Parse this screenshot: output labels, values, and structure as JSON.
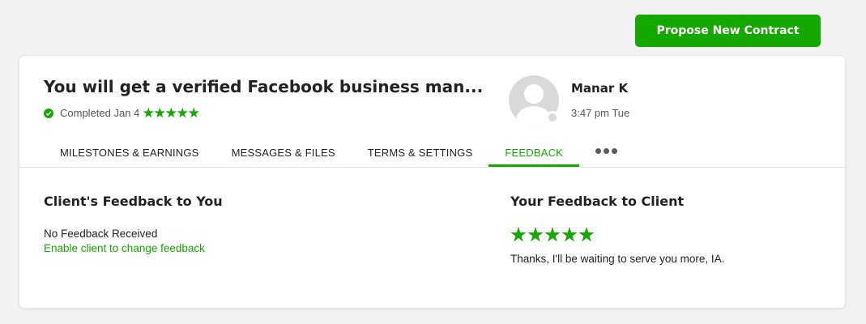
{
  "header": {
    "propose_button": "Propose New Contract"
  },
  "contract": {
    "title": "You will get a verified Facebook business man...",
    "status_text": "Completed Jan 4",
    "status_rating": 5
  },
  "client": {
    "name": "Manar K",
    "local_time": "3:47 pm Tue"
  },
  "tabs": [
    {
      "label": "MILESTONES & EARNINGS",
      "active": false
    },
    {
      "label": "MESSAGES & FILES",
      "active": false
    },
    {
      "label": "TERMS & SETTINGS",
      "active": false
    },
    {
      "label": "FEEDBACK",
      "active": true
    }
  ],
  "feedback": {
    "client_heading": "Client's Feedback to You",
    "client_status": "No Feedback Received",
    "enable_link": "Enable client to change feedback",
    "your_heading": "Your Feedback to Client",
    "your_rating": 5,
    "your_comment": "Thanks, I'll be waiting to serve you more, IA."
  },
  "colors": {
    "accent": "#14a800",
    "background": "#f2f2f2",
    "avatar_placeholder": "#d9d9d9"
  },
  "icons": [
    "check-circle-icon",
    "star-icon",
    "avatar-placeholder-icon",
    "more-horizontal-icon"
  ]
}
